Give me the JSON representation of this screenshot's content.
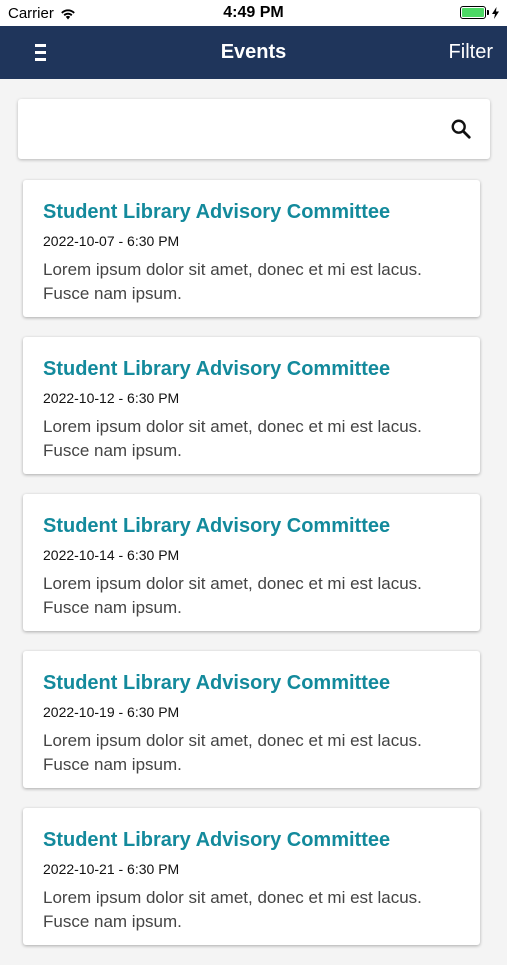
{
  "status": {
    "carrier": "Carrier",
    "time": "4:49 PM"
  },
  "nav": {
    "title": "Events",
    "filter_label": "Filter"
  },
  "search": {
    "value": "",
    "placeholder": ""
  },
  "events": [
    {
      "title": "Student Library Advisory Committee",
      "datetime": "2022-10-07 - 6:30 PM",
      "description": "Lorem ipsum dolor sit amet, donec et mi est lacus. Fusce nam ipsum."
    },
    {
      "title": "Student Library Advisory Committee",
      "datetime": "2022-10-12 - 6:30 PM",
      "description": "Lorem ipsum dolor sit amet, donec et mi est lacus. Fusce nam ipsum."
    },
    {
      "title": "Student Library Advisory Committee",
      "datetime": "2022-10-14 - 6:30 PM",
      "description": "Lorem ipsum dolor sit amet, donec et mi est lacus. Fusce nam ipsum."
    },
    {
      "title": "Student Library Advisory Committee",
      "datetime": "2022-10-19 - 6:30 PM",
      "description": "Lorem ipsum dolor sit amet, donec et mi est lacus. Fusce nam ipsum."
    },
    {
      "title": "Student Library Advisory Committee",
      "datetime": "2022-10-21 - 6:30 PM",
      "description": "Lorem ipsum dolor sit amet, donec et mi est lacus. Fusce nam ipsum."
    }
  ],
  "icons": {
    "menu": "menu-icon",
    "search": "search-icon",
    "wifi": "wifi-icon",
    "battery": "battery-icon",
    "charging": "charging-icon"
  },
  "colors": {
    "nav_background": "#1f355b",
    "event_title": "#138a9c",
    "battery_fill": "#4cd964"
  }
}
